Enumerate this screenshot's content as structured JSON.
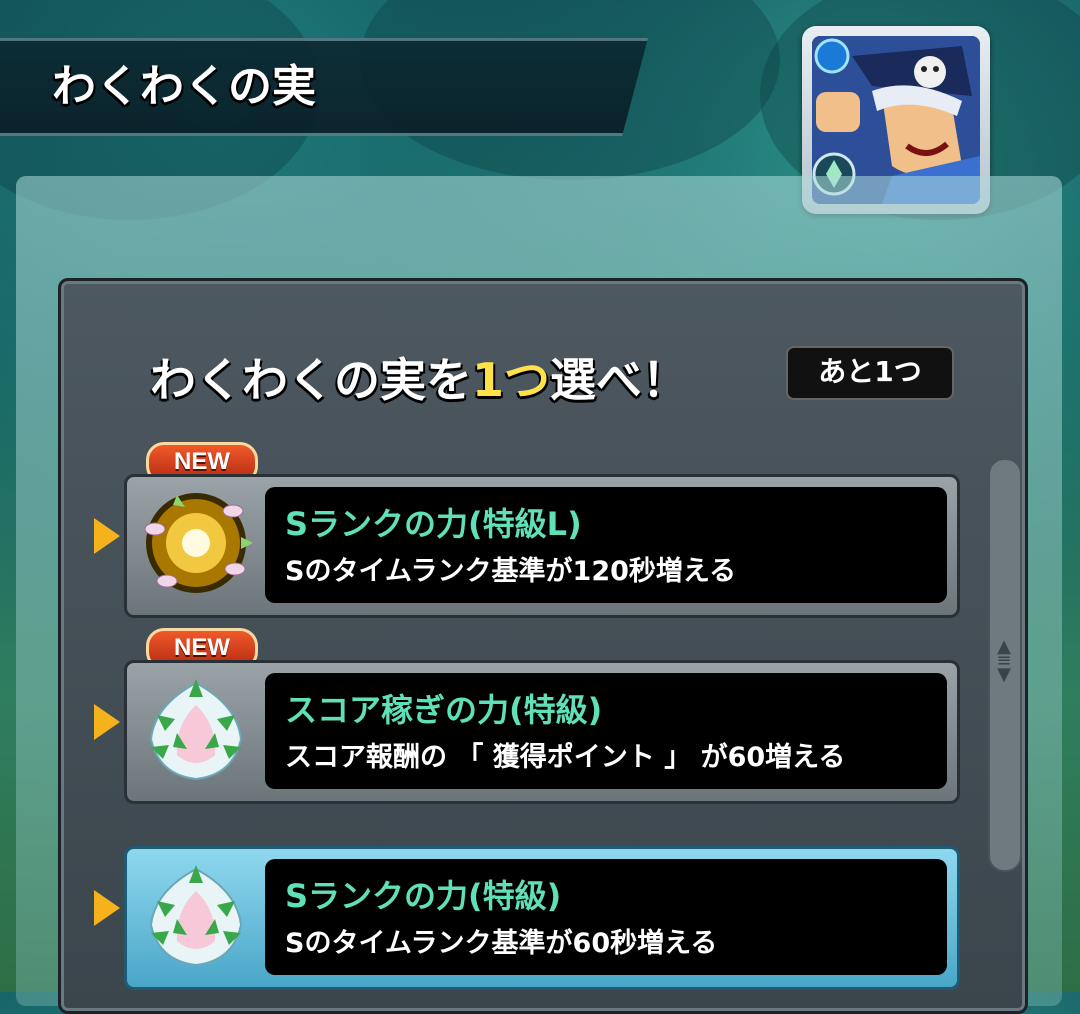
{
  "header": {
    "title": "わくわくの実"
  },
  "panel": {
    "heading_prefix": "わくわくの実を",
    "heading_count": "1つ",
    "heading_suffix": "選べ！",
    "remaining_label": "あと1つ"
  },
  "items": [
    {
      "badge": "NEW",
      "name": "Sランクの力(特級L)",
      "description": "Sのタイムランク基準が120秒増える",
      "icon": "golden-burst-fruit-icon"
    },
    {
      "badge": "NEW",
      "name": "スコア稼ぎの力(特級)",
      "description": "スコア報酬の 「 獲得ポイント 」 が60増える",
      "icon": "lotus-fruit-icon"
    },
    {
      "badge": "",
      "name": "Sランクの力(特級)",
      "description": "Sのタイムランク基準が60秒増える",
      "icon": "lotus-fruit-icon"
    }
  ],
  "colors": {
    "item_name": "#5fe0b8",
    "heading_count": "#ffe14a",
    "arrow": "#f5b21c",
    "selected_row": "#4aa6c8"
  }
}
